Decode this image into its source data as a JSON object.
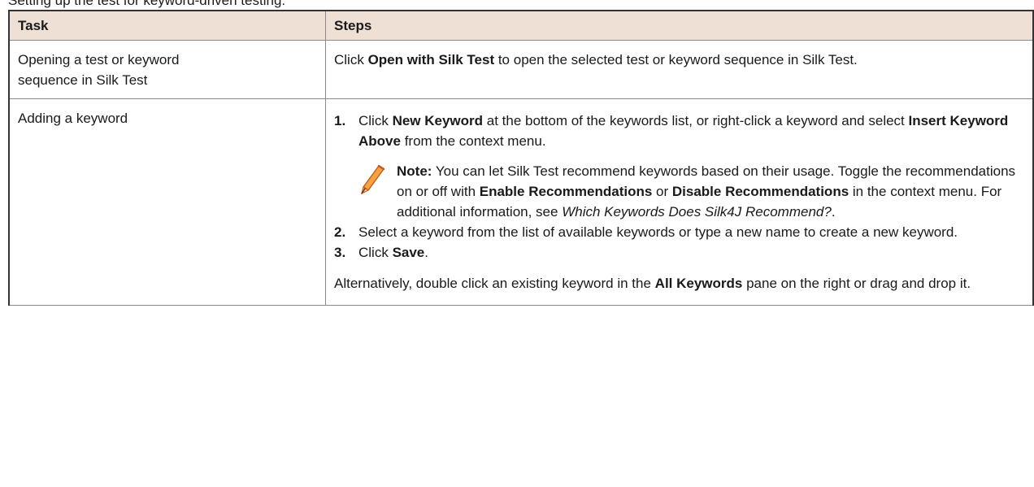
{
  "caption": "Setting up the test for keyword-driven testing:",
  "table": {
    "headers": [
      "Task",
      "Steps"
    ],
    "row1": {
      "task": [
        "Opening a test or keyword",
        "sequence in Silk Test"
      ],
      "steps_pre": "Click ",
      "steps_bold": "Open with Silk Test",
      "steps_post": " to open the selected test or keyword sequence in Silk Test."
    },
    "row2": {
      "task": "Adding a keyword",
      "step1": {
        "num": "1.",
        "t1": "Click ",
        "b1": "New Keyword",
        "t2": " at the bottom of the keywords list, or right-click a keyword and select ",
        "b2": "Insert Keyword Above",
        "t3": " from the context menu."
      },
      "note": {
        "label": "Note:",
        "t1": " You can let Silk Test recommend keywords based on their usage. Toggle the recommendations on or off with ",
        "b1": "Enable Recommendations",
        "t2": " or ",
        "b2": "Disable Recommendations",
        "t3": " in the context menu. For additional information, see ",
        "i1": "Which Keywords Does Silk4J Recommend?",
        "t4": "."
      },
      "step2": {
        "num": "2.",
        "text": "Select a keyword from the list of available keywords or type a new name to create a new keyword."
      },
      "step3": {
        "num": "3.",
        "t1": "Click ",
        "b1": "Save",
        "t2": "."
      },
      "alt": {
        "t1": "Alternatively, double click an existing keyword in the ",
        "b1": "All Keywords",
        "t2": " pane on the right or drag and drop it."
      }
    }
  },
  "icons": {
    "note": "pencil-icon",
    "pencil_fill": "#f4a340",
    "pencil_stroke": "#c45a1a"
  },
  "colors": {
    "header_bg": "#efe0d6",
    "border": "#8a8a8a"
  }
}
